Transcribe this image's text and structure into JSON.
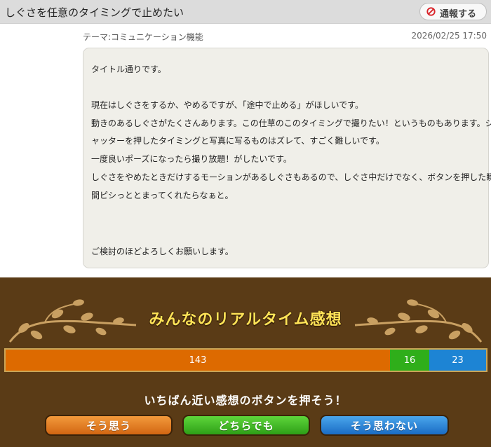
{
  "header": {
    "title": "しぐさを任意のタイミングで止めたい",
    "report_label": "通報する"
  },
  "post": {
    "theme": "テーマ:コミュニケーション機能",
    "timestamp": "2026/02/25 17:50",
    "lines": [
      "タイトル通りです。",
      "現在はしぐさをするか、やめるですが、「途中で止める」がほしいです。",
      "動きのあるしぐさがたくさんあります。この仕草のこのタイミングで撮りたい！というものもあります。シ",
      "ャッターを押したタイミングと写真に写るものはズレて、すごく難しいです。",
      "一度良いポーズになったら撮り放題！がしたいです。",
      "しぐさをやめたときだけするモーションがあるしぐさもあるので、しぐさ中だけでなく、ボタンを押した瞬",
      "間ピシっととまってくれたらなぁと。",
      "ご検討のほどよろしくお願いします。"
    ]
  },
  "reactions": {
    "title": "みんなのリアルタイム感想",
    "agree_count": "143",
    "neutral_count": "16",
    "disagree_count": "23",
    "prompt": "いちばん近い感想のボタンを押そう！",
    "agree_label": "そう思う",
    "neutral_label": "どちらでも",
    "disagree_label": "そう思わない"
  },
  "colors": {
    "agree": "#dd6a00",
    "neutral": "#2fae1a",
    "disagree": "#1d84d4",
    "panel_bg": "#5a3b16",
    "title_yellow": "#ffe357"
  },
  "icons": {
    "report": "prohibited-icon",
    "ornament": "vine-ornament-icon"
  }
}
